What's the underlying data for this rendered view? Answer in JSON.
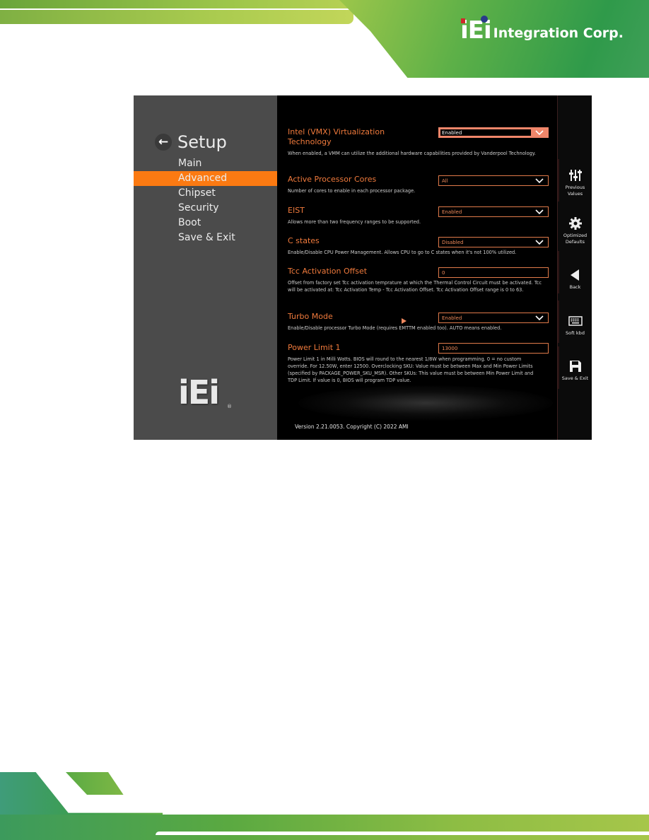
{
  "page_header": {
    "brand_logo_letters": "iEi",
    "brand_logo_text": "Integration Corp."
  },
  "bios": {
    "setup_title": "Setup",
    "menu": [
      {
        "label": "Main",
        "active": false
      },
      {
        "label": "Advanced",
        "active": true
      },
      {
        "label": "Chipset",
        "active": false
      },
      {
        "label": "Security",
        "active": false
      },
      {
        "label": "Boot",
        "active": false
      },
      {
        "label": "Save & Exit",
        "active": false
      }
    ],
    "panel_logo": "iEi",
    "panel_logo_mark": "®",
    "settings": [
      {
        "label": "Intel (VMX) Virtualization Technology",
        "value": "Enabled",
        "control": "dropdown",
        "focused": true,
        "description": "When enabled, a VMM can utilize the additional hardware capabilities provided by Vanderpool Technology."
      },
      {
        "label": "Active Processor Cores",
        "value": "All",
        "control": "dropdown",
        "focused": false,
        "description": "Number of cores to enable in each processor package."
      },
      {
        "label": "EIST",
        "value": "Enabled",
        "control": "dropdown",
        "focused": false,
        "description": "Allows more than two frequency ranges to be supported."
      },
      {
        "label": "C states",
        "value": "Disabled",
        "control": "dropdown",
        "focused": false,
        "description": "Enable/Disable CPU Power Management. Allows CPU to go to C states when it's not 100% utilized."
      },
      {
        "label": "Tcc Activation Offset",
        "value": "0",
        "control": "text",
        "focused": false,
        "description": "Offset from factory set Tcc activation temprature at which the Thermal Control Circuit must be activated. Tcc will be activated at: Tcc Activation Temp - Tcc Activation Offset. Tcc Activation Offset range is 0 to 63."
      },
      {
        "label": "Turbo Mode",
        "value": "Enabled",
        "control": "dropdown",
        "focused": false,
        "description": "Enable/Disable processor Turbo Mode (requires EMTTM enabled too). AUTO means enabled."
      },
      {
        "label": "Power Limit 1",
        "value": "13000",
        "control": "text",
        "focused": false,
        "description": "Power Limit 1 in Milli Watts. BIOS will round to the nearest 1/8W when programming. 0 = no custom override. For 12.50W, enter 12500. Overclocking SKU: Value must be between Max and Min Power Limits (specified by PACKAGE_POWER_SKU_MSR). Other SKUs: This value must be between Min Power Limit and TDP Limit. If value is 0, BIOS will program TDP value."
      }
    ],
    "version": "Version 2.21.0053. Copyright (C) 2022 AMI",
    "toolbar": [
      {
        "label": "Previous Values",
        "icon": "sliders-icon"
      },
      {
        "label": "Optimized Defaults",
        "icon": "gear-icon"
      },
      {
        "label": "Back",
        "icon": "back-triangle-icon"
      },
      {
        "label": "Soft kbd",
        "icon": "keyboard-icon"
      },
      {
        "label": "Save & Exit",
        "icon": "floppy-disk-icon"
      }
    ],
    "colors": {
      "accent": "#fb7a12",
      "label": "#f07a3c",
      "focus": "#f0866a",
      "panel": "#4b4b4b"
    }
  }
}
